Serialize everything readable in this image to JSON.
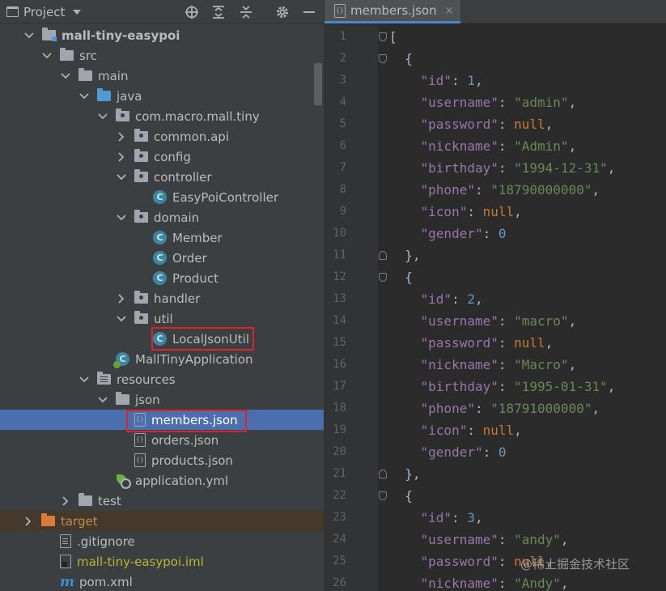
{
  "project_panel": {
    "title": "Project",
    "toolbar": {
      "locate": "crosshair-icon",
      "expand_all": "expand-all-icon",
      "collapse_all": "collapse-all-icon",
      "settings": "gear-icon",
      "hide": "minimize-icon"
    },
    "tree": [
      {
        "label": "mall-tiny-easypoi",
        "icon": "module",
        "arrow": "down"
      },
      {
        "label": "src",
        "icon": "folder",
        "arrow": "down"
      },
      {
        "label": "main",
        "icon": "folder",
        "arrow": "down"
      },
      {
        "label": "java",
        "icon": "source-folder",
        "arrow": "down"
      },
      {
        "label": "com.macro.mall.tiny",
        "icon": "package",
        "arrow": "down"
      },
      {
        "label": "common.api",
        "icon": "package",
        "arrow": "right"
      },
      {
        "label": "config",
        "icon": "package",
        "arrow": "right"
      },
      {
        "label": "controller",
        "icon": "package",
        "arrow": "down"
      },
      {
        "label": "EasyPoiController",
        "icon": "class",
        "arrow": ""
      },
      {
        "label": "domain",
        "icon": "package",
        "arrow": "down"
      },
      {
        "label": "Member",
        "icon": "class",
        "arrow": ""
      },
      {
        "label": "Order",
        "icon": "class",
        "arrow": ""
      },
      {
        "label": "Product",
        "icon": "class",
        "arrow": ""
      },
      {
        "label": "handler",
        "icon": "package",
        "arrow": "right"
      },
      {
        "label": "util",
        "icon": "package",
        "arrow": "down"
      },
      {
        "label": "LocalJsonUtil",
        "icon": "class",
        "arrow": ""
      },
      {
        "label": "MallTinyApplication",
        "icon": "app-class",
        "arrow": ""
      },
      {
        "label": "resources",
        "icon": "resources-folder",
        "arrow": "down"
      },
      {
        "label": "json",
        "icon": "folder",
        "arrow": "down"
      },
      {
        "label": "members.json",
        "icon": "json-file",
        "arrow": ""
      },
      {
        "label": "orders.json",
        "icon": "json-file",
        "arrow": ""
      },
      {
        "label": "products.json",
        "icon": "json-file",
        "arrow": ""
      },
      {
        "label": "application.yml",
        "icon": "yml-file",
        "arrow": ""
      },
      {
        "label": "test",
        "icon": "folder",
        "arrow": "right"
      },
      {
        "label": "target",
        "icon": "excluded-folder",
        "arrow": "right"
      },
      {
        "label": ".gitignore",
        "icon": "text-file",
        "arrow": ""
      },
      {
        "label": "mall-tiny-easypoi.iml",
        "icon": "iml-file",
        "arrow": ""
      },
      {
        "label": "pom.xml",
        "icon": "maven-file",
        "arrow": ""
      }
    ]
  },
  "editor": {
    "tab": {
      "label": "members.json",
      "close": "×"
    },
    "lines": [
      [
        [
          "punc",
          "["
        ]
      ],
      [
        [
          "punc",
          "  {"
        ]
      ],
      [
        [
          "punc",
          "    "
        ],
        [
          "key",
          "\"id\""
        ],
        [
          "punc",
          ": "
        ],
        [
          "num",
          "1"
        ],
        [
          "punc",
          ","
        ]
      ],
      [
        [
          "punc",
          "    "
        ],
        [
          "key",
          "\"username\""
        ],
        [
          "punc",
          ": "
        ],
        [
          "str",
          "\"admin\""
        ],
        [
          "punc",
          ","
        ]
      ],
      [
        [
          "punc",
          "    "
        ],
        [
          "key",
          "\"password\""
        ],
        [
          "punc",
          ": "
        ],
        [
          "kw",
          "null"
        ],
        [
          "punc",
          ","
        ]
      ],
      [
        [
          "punc",
          "    "
        ],
        [
          "key",
          "\"nickname\""
        ],
        [
          "punc",
          ": "
        ],
        [
          "str",
          "\"Admin\""
        ],
        [
          "punc",
          ","
        ]
      ],
      [
        [
          "punc",
          "    "
        ],
        [
          "key",
          "\"birthday\""
        ],
        [
          "punc",
          ": "
        ],
        [
          "str",
          "\"1994-12-31\""
        ],
        [
          "punc",
          ","
        ]
      ],
      [
        [
          "punc",
          "    "
        ],
        [
          "key",
          "\"phone\""
        ],
        [
          "punc",
          ": "
        ],
        [
          "str",
          "\"18790000000\""
        ],
        [
          "punc",
          ","
        ]
      ],
      [
        [
          "punc",
          "    "
        ],
        [
          "key",
          "\"icon\""
        ],
        [
          "punc",
          ": "
        ],
        [
          "kw",
          "null"
        ],
        [
          "punc",
          ","
        ]
      ],
      [
        [
          "punc",
          "    "
        ],
        [
          "key",
          "\"gender\""
        ],
        [
          "punc",
          ": "
        ],
        [
          "num",
          "0"
        ]
      ],
      [
        [
          "punc",
          "  },"
        ]
      ],
      [
        [
          "punc",
          "  {"
        ]
      ],
      [
        [
          "punc",
          "    "
        ],
        [
          "key",
          "\"id\""
        ],
        [
          "punc",
          ": "
        ],
        [
          "num",
          "2"
        ],
        [
          "punc",
          ","
        ]
      ],
      [
        [
          "punc",
          "    "
        ],
        [
          "key",
          "\"username\""
        ],
        [
          "punc",
          ": "
        ],
        [
          "str",
          "\"macro\""
        ],
        [
          "punc",
          ","
        ]
      ],
      [
        [
          "punc",
          "    "
        ],
        [
          "key",
          "\"password\""
        ],
        [
          "punc",
          ": "
        ],
        [
          "kw",
          "null"
        ],
        [
          "punc",
          ","
        ]
      ],
      [
        [
          "punc",
          "    "
        ],
        [
          "key",
          "\"nickname\""
        ],
        [
          "punc",
          ": "
        ],
        [
          "str",
          "\"Macro\""
        ],
        [
          "punc",
          ","
        ]
      ],
      [
        [
          "punc",
          "    "
        ],
        [
          "key",
          "\"birthday\""
        ],
        [
          "punc",
          ": "
        ],
        [
          "str",
          "\"1995-01-31\""
        ],
        [
          "punc",
          ","
        ]
      ],
      [
        [
          "punc",
          "    "
        ],
        [
          "key",
          "\"phone\""
        ],
        [
          "punc",
          ": "
        ],
        [
          "str",
          "\"18791000000\""
        ],
        [
          "punc",
          ","
        ]
      ],
      [
        [
          "punc",
          "    "
        ],
        [
          "key",
          "\"icon\""
        ],
        [
          "punc",
          ": "
        ],
        [
          "kw",
          "null"
        ],
        [
          "punc",
          ","
        ]
      ],
      [
        [
          "punc",
          "    "
        ],
        [
          "key",
          "\"gender\""
        ],
        [
          "punc",
          ": "
        ],
        [
          "num",
          "0"
        ]
      ],
      [
        [
          "punc",
          "  },"
        ]
      ],
      [
        [
          "punc",
          "  {"
        ]
      ],
      [
        [
          "punc",
          "    "
        ],
        [
          "key",
          "\"id\""
        ],
        [
          "punc",
          ": "
        ],
        [
          "num",
          "3"
        ],
        [
          "punc",
          ","
        ]
      ],
      [
        [
          "punc",
          "    "
        ],
        [
          "key",
          "\"username\""
        ],
        [
          "punc",
          ": "
        ],
        [
          "str",
          "\"andy\""
        ],
        [
          "punc",
          ","
        ]
      ],
      [
        [
          "punc",
          "    "
        ],
        [
          "key",
          "\"password\""
        ],
        [
          "punc",
          ": "
        ],
        [
          "kw",
          "null"
        ],
        [
          "punc",
          ","
        ]
      ],
      [
        [
          "punc",
          "    "
        ],
        [
          "key",
          "\"nickname\""
        ],
        [
          "punc",
          ": "
        ],
        [
          "str",
          "\"Andy\""
        ],
        [
          "punc",
          ","
        ]
      ]
    ]
  },
  "watermark": "@稀土掘金技术社区"
}
